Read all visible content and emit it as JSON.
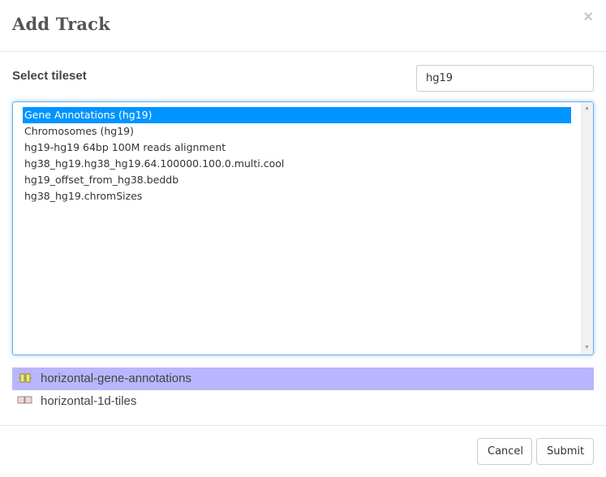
{
  "dialog": {
    "title": "Add Track",
    "close_symbol": "×"
  },
  "tileset_picker": {
    "label": "Select tileset",
    "search_value": "hg19",
    "options": [
      {
        "label": "Gene Annotations (hg19)",
        "selected": true
      },
      {
        "label": "Chromosomes (hg19)",
        "selected": false
      },
      {
        "label": "hg19-hg19 64bp 100M reads alignment",
        "selected": false
      },
      {
        "label": "hg38_hg19.hg38_hg19.64.100000.100.0.multi.cool",
        "selected": false
      },
      {
        "label": "hg19_offset_from_hg38.beddb",
        "selected": false
      },
      {
        "label": "hg38_hg19.chromSizes",
        "selected": false
      }
    ],
    "scroll_up_symbol": "▲",
    "scroll_down_symbol": "▼"
  },
  "track_types": [
    {
      "label": "horizontal-gene-annotations",
      "icon": "gene-annotations-icon",
      "selected": true
    },
    {
      "label": "horizontal-1d-tiles",
      "icon": "1d-tiles-icon",
      "selected": false
    }
  ],
  "footer": {
    "cancel_label": "Cancel",
    "submit_label": "Submit"
  },
  "colors": {
    "selected_option": "#0094ff",
    "selected_track_type": "#b9b6fd",
    "focus_border": "#66afe9"
  }
}
